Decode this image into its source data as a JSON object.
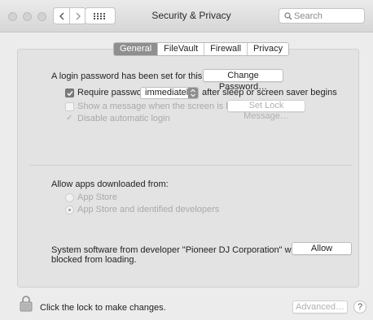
{
  "window": {
    "title": "Security & Privacy"
  },
  "toolbar": {
    "search_placeholder": "Search"
  },
  "tabs": [
    {
      "label": "General",
      "active": true
    },
    {
      "label": "FileVault",
      "active": false
    },
    {
      "label": "Firewall",
      "active": false
    },
    {
      "label": "Privacy",
      "active": false
    }
  ],
  "general": {
    "login_text": "A login password has been set for this user",
    "change_password_label": "Change Password…",
    "require_password": {
      "label": "Require password",
      "checked": true
    },
    "require_select_value": "immediately",
    "after_sleep_text": "after sleep or screen saver begins",
    "show_message": {
      "label": "Show a message when the screen is locked",
      "checked": false,
      "enabled": false
    },
    "set_lock_message_label": "Set Lock Message…",
    "disable_login": {
      "label": "Disable automatic login",
      "checked": true,
      "enabled": false
    },
    "allow_apps_heading": "Allow apps downloaded from:",
    "app_store_option": "App Store",
    "identified_option": "App Store and identified developers",
    "blocked_text_line1": "System software from developer \"Pioneer DJ Corporation\" was",
    "blocked_text_line2": "blocked from loading.",
    "allow_label": "Allow"
  },
  "footer": {
    "lock_text": "Click the lock to make changes.",
    "advanced_label": "Advanced…",
    "help_label": "?"
  },
  "colors": {
    "active_tab": "#8f8f8f",
    "window_bg": "#ececec",
    "panel_bg": "#e3e3e3"
  }
}
